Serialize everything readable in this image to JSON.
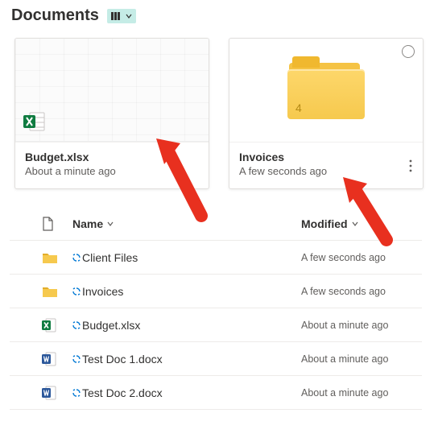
{
  "header": {
    "title": "Documents"
  },
  "tiles": [
    {
      "kind": "excel",
      "title": "Budget.xlsx",
      "subtitle": "About a minute ago"
    },
    {
      "kind": "folder",
      "title": "Invoices",
      "subtitle": "A few seconds ago",
      "badge_count": "4"
    }
  ],
  "list": {
    "columns": {
      "name": "Name",
      "modified": "Modified"
    },
    "rows": [
      {
        "icon": "folder",
        "name": "Client Files",
        "modified": "A few seconds ago"
      },
      {
        "icon": "folder",
        "name": "Invoices",
        "modified": "A few seconds ago"
      },
      {
        "icon": "excel",
        "name": "Budget.xlsx",
        "modified": "About a minute ago"
      },
      {
        "icon": "word",
        "name": "Test Doc 1.docx",
        "modified": "About a minute ago"
      },
      {
        "icon": "word",
        "name": "Test Doc 2.docx",
        "modified": "About a minute ago"
      }
    ]
  }
}
